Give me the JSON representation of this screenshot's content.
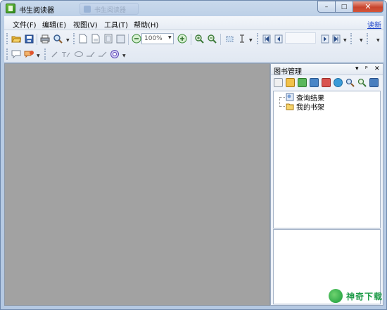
{
  "window": {
    "title": "书生阅读器",
    "ghost_tab_label": "书生阅读器"
  },
  "window_controls": {
    "minimize": "–",
    "maximize": "□",
    "close": "✕"
  },
  "menu": {
    "items": [
      "文件(F)",
      "编辑(E)",
      "视图(V)",
      "工具(T)",
      "帮助(H)"
    ],
    "right_link": "读新"
  },
  "toolbar": {
    "zoom_value": "100%"
  },
  "panel": {
    "title": "图书管理",
    "controls": {
      "dropdown": "▾",
      "pin": "ᵖ",
      "close": "✕"
    },
    "tree": [
      {
        "label": "查询结果",
        "icon": "search-results-icon"
      },
      {
        "label": "我的书架",
        "icon": "folder-icon"
      }
    ]
  },
  "watermark": {
    "text": "神奇下载"
  },
  "colors": {
    "doc_background": "#a2a2a2",
    "accent_link": "#1a40c8",
    "close_button": "#c8442d",
    "watermark": "#1d9a47"
  }
}
